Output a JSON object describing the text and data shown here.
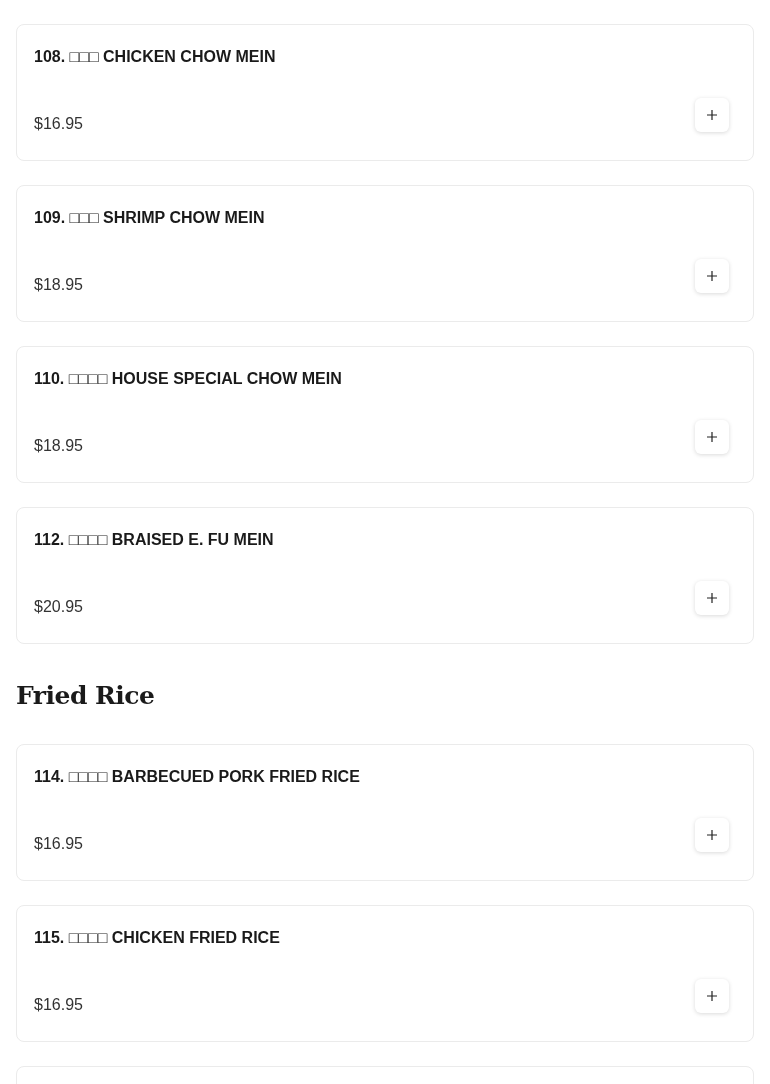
{
  "sections": [
    {
      "items": [
        {
          "name": "108. □□□ CHICKEN CHOW MEIN",
          "price": "$16.95"
        },
        {
          "name": "109. □□□ SHRIMP CHOW MEIN",
          "price": "$18.95"
        },
        {
          "name": "110. □□□□ HOUSE SPECIAL CHOW MEIN",
          "price": "$18.95"
        },
        {
          "name": "112. □□□□ BRAISED E. FU MEIN",
          "price": "$20.95"
        }
      ]
    },
    {
      "title": "Fried Rice",
      "items": [
        {
          "name": "114. □□□□ BARBECUED PORK FRIED RICE",
          "price": "$16.95"
        },
        {
          "name": "115. □□□□ CHICKEN FRIED RICE",
          "price": "$16.95"
        }
      ]
    }
  ]
}
